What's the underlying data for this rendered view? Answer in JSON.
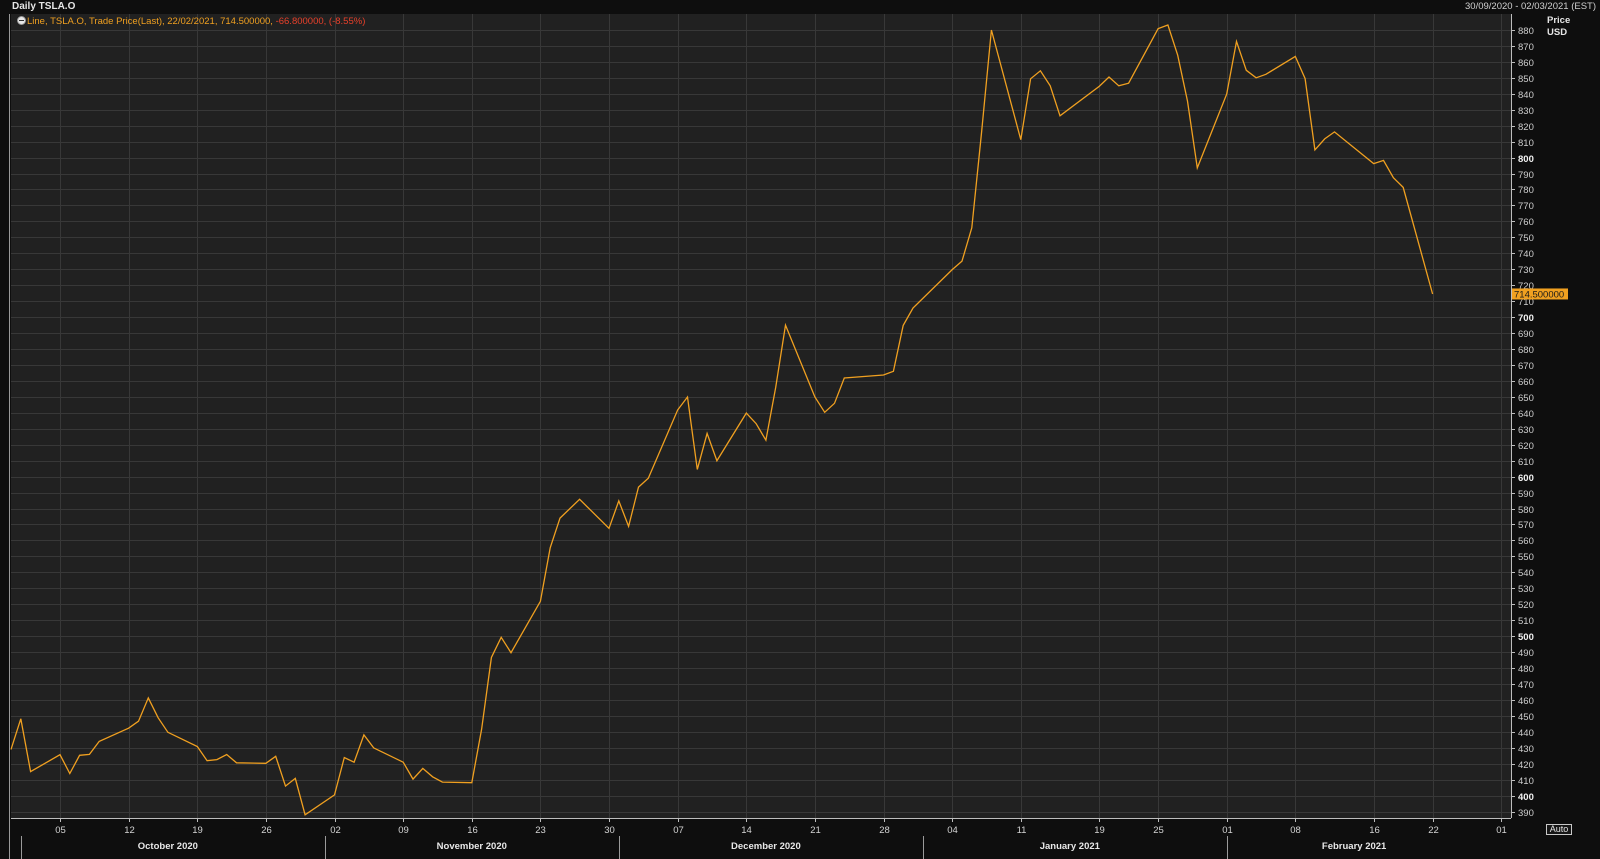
{
  "window": {
    "title": "Daily TSLA.O",
    "date_range": "30/09/2020 - 02/03/2021 (EST)"
  },
  "legend": {
    "main": "Line, TSLA.O, Trade Price(Last),  22/02/2021, 714.500000,",
    "change": " -66.800000,  (-8.55%)"
  },
  "y_axis_header": {
    "line1": "Price",
    "line2": "USD"
  },
  "auto_button": "Auto",
  "colors": {
    "background": "#0e0e0e",
    "plot": "#212121",
    "grid": "#383838",
    "line": "#f0a020",
    "negative": "#e8402a",
    "price_tag": "#f0a020"
  },
  "chart_data": {
    "type": "line",
    "title": "Daily TSLA.O",
    "ylabel": "Price USD",
    "ylim": [
      386,
      890
    ],
    "y_ticks": [
      390,
      400,
      410,
      420,
      430,
      440,
      450,
      460,
      470,
      480,
      490,
      500,
      510,
      520,
      530,
      540,
      550,
      560,
      570,
      580,
      590,
      600,
      610,
      620,
      630,
      640,
      650,
      660,
      670,
      680,
      690,
      700,
      710,
      720,
      730,
      740,
      750,
      760,
      770,
      780,
      790,
      800,
      810,
      820,
      830,
      840,
      850,
      860,
      870,
      880
    ],
    "y_bold_ticks": [
      400,
      500,
      600,
      700,
      800
    ],
    "x_range": [
      "2020-09-30",
      "2021-03-02"
    ],
    "x_tick_labels": [
      {
        "date": "2020-10-05",
        "label": "05"
      },
      {
        "date": "2020-10-12",
        "label": "12"
      },
      {
        "date": "2020-10-19",
        "label": "19"
      },
      {
        "date": "2020-10-26",
        "label": "26"
      },
      {
        "date": "2020-11-02",
        "label": "02"
      },
      {
        "date": "2020-11-09",
        "label": "09"
      },
      {
        "date": "2020-11-16",
        "label": "16"
      },
      {
        "date": "2020-11-23",
        "label": "23"
      },
      {
        "date": "2020-11-30",
        "label": "30"
      },
      {
        "date": "2020-12-07",
        "label": "07"
      },
      {
        "date": "2020-12-14",
        "label": "14"
      },
      {
        "date": "2020-12-21",
        "label": "21"
      },
      {
        "date": "2020-12-28",
        "label": "28"
      },
      {
        "date": "2021-01-04",
        "label": "04"
      },
      {
        "date": "2021-01-11",
        "label": "11"
      },
      {
        "date": "2021-01-19",
        "label": "19"
      },
      {
        "date": "2021-01-25",
        "label": "25"
      },
      {
        "date": "2021-02-01",
        "label": "01"
      },
      {
        "date": "2021-02-08",
        "label": "08"
      },
      {
        "date": "2021-02-16",
        "label": "16"
      },
      {
        "date": "2021-02-22",
        "label": "22"
      },
      {
        "date": "2021-03-01",
        "label": "01"
      }
    ],
    "month_labels": [
      {
        "date": "2020-10-16",
        "label": "October 2020"
      },
      {
        "date": "2020-11-16",
        "label": "November 2020"
      },
      {
        "date": "2020-12-16",
        "label": "December 2020"
      },
      {
        "date": "2021-01-16",
        "label": "January 2021"
      },
      {
        "date": "2021-02-14",
        "label": "February 2021"
      }
    ],
    "month_separators": [
      "2020-10-01",
      "2020-11-01",
      "2020-12-01",
      "2021-01-01",
      "2021-02-01"
    ],
    "last_value_label": "714.500000",
    "last_value": 714.5,
    "series": [
      {
        "name": "TSLA.O",
        "x": [
          "2020-09-30",
          "2020-10-01",
          "2020-10-02",
          "2020-10-05",
          "2020-10-06",
          "2020-10-07",
          "2020-10-08",
          "2020-10-09",
          "2020-10-12",
          "2020-10-13",
          "2020-10-14",
          "2020-10-15",
          "2020-10-16",
          "2020-10-19",
          "2020-10-20",
          "2020-10-21",
          "2020-10-22",
          "2020-10-23",
          "2020-10-26",
          "2020-10-27",
          "2020-10-28",
          "2020-10-29",
          "2020-10-30",
          "2020-11-02",
          "2020-11-03",
          "2020-11-04",
          "2020-11-05",
          "2020-11-06",
          "2020-11-09",
          "2020-11-10",
          "2020-11-11",
          "2020-11-12",
          "2020-11-13",
          "2020-11-16",
          "2020-11-17",
          "2020-11-18",
          "2020-11-19",
          "2020-11-20",
          "2020-11-23",
          "2020-11-24",
          "2020-11-25",
          "2020-11-27",
          "2020-11-30",
          "2020-12-01",
          "2020-12-02",
          "2020-12-03",
          "2020-12-04",
          "2020-12-07",
          "2020-12-08",
          "2020-12-09",
          "2020-12-10",
          "2020-12-11",
          "2020-12-14",
          "2020-12-15",
          "2020-12-16",
          "2020-12-17",
          "2020-12-18",
          "2020-12-21",
          "2020-12-22",
          "2020-12-23",
          "2020-12-24",
          "2020-12-28",
          "2020-12-29",
          "2020-12-30",
          "2020-12-31",
          "2021-01-04",
          "2021-01-05",
          "2021-01-06",
          "2021-01-07",
          "2021-01-08",
          "2021-01-11",
          "2021-01-12",
          "2021-01-13",
          "2021-01-14",
          "2021-01-15",
          "2021-01-19",
          "2021-01-20",
          "2021-01-21",
          "2021-01-22",
          "2021-01-25",
          "2021-01-26",
          "2021-01-27",
          "2021-01-28",
          "2021-01-29",
          "2021-02-01",
          "2021-02-02",
          "2021-02-03",
          "2021-02-04",
          "2021-02-05",
          "2021-02-08",
          "2021-02-09",
          "2021-02-10",
          "2021-02-11",
          "2021-02-12",
          "2021-02-16",
          "2021-02-17",
          "2021-02-18",
          "2021-02-19",
          "2021-02-22"
        ],
        "values": [
          429.0,
          448.2,
          415.1,
          425.7,
          413.9,
          425.3,
          425.9,
          434.0,
          442.3,
          446.7,
          461.3,
          448.9,
          439.7,
          430.8,
          421.9,
          422.6,
          425.8,
          420.6,
          420.3,
          424.7,
          406.0,
          410.8,
          388.0,
          400.5,
          423.9,
          420.98,
          438.1,
          429.95,
          421.0,
          410.4,
          417.1,
          411.8,
          408.5,
          408.1,
          441.6,
          486.6,
          499.3,
          489.6,
          521.85,
          555.4,
          574.0,
          585.8,
          567.6,
          584.8,
          568.8,
          593.4,
          599.0,
          641.8,
          649.9,
          604.5,
          627.1,
          609.99,
          639.8,
          633.25,
          622.8,
          655.9,
          695.0,
          649.9,
          640.3,
          645.98,
          661.8,
          663.7,
          665.99,
          694.8,
          705.7,
          729.8,
          735.1,
          755.98,
          816.0,
          880.0,
          811.2,
          849.4,
          854.4,
          845.0,
          826.2,
          844.6,
          850.5,
          844.99,
          846.6,
          880.8,
          883.1,
          864.2,
          835.4,
          793.5,
          839.8,
          872.8,
          854.7,
          849.99,
          852.2,
          863.4,
          849.5,
          804.8,
          811.7,
          816.1,
          796.2,
          798.2,
          787.4,
          781.3,
          714.5
        ]
      }
    ]
  }
}
